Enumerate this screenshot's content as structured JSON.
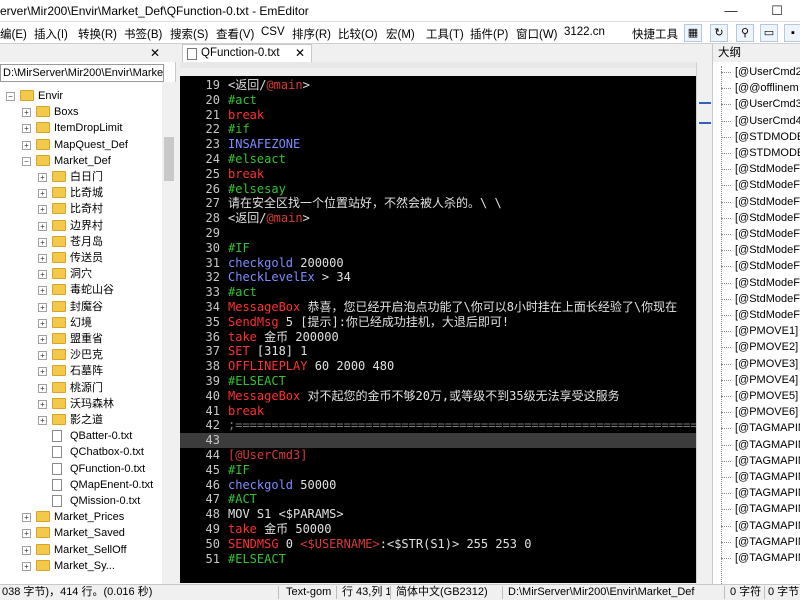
{
  "window": {
    "title": "erver\\Mir200\\Envir\\Market_Def\\QFunction-0.txt - EmEditor",
    "minimize": "—",
    "maximize": "☐"
  },
  "menu": {
    "items": [
      "编(E)",
      "插入(I)",
      "转换(R)",
      "书签(B)",
      "搜索(S)",
      "查看(V)",
      "CSV",
      "排序(R)",
      "比较(O)",
      "宏(M)",
      "工具(T)",
      "插件(P)",
      "窗口(W)",
      "3122.cn",
      "快捷工具"
    ]
  },
  "left_panel": {
    "path": "D:\\MirServer\\Mir200\\Envir\\Market",
    "close": "✕",
    "tree": [
      {
        "label": "Envir",
        "type": "folder",
        "level": 0,
        "expand": "−"
      },
      {
        "label": "Boxs",
        "type": "folder",
        "level": 1,
        "expand": "+"
      },
      {
        "label": "ItemDropLimit",
        "type": "folder",
        "level": 1,
        "expand": "+"
      },
      {
        "label": "MapQuest_Def",
        "type": "folder",
        "level": 1,
        "expand": "+"
      },
      {
        "label": "Market_Def",
        "type": "folder",
        "level": 1,
        "expand": "−"
      },
      {
        "label": "白日门",
        "type": "folder",
        "level": 2,
        "expand": "+"
      },
      {
        "label": "比奇城",
        "type": "folder",
        "level": 2,
        "expand": "+"
      },
      {
        "label": "比奇村",
        "type": "folder",
        "level": 2,
        "expand": "+"
      },
      {
        "label": "边界村",
        "type": "folder",
        "level": 2,
        "expand": "+"
      },
      {
        "label": "苍月岛",
        "type": "folder",
        "level": 2,
        "expand": "+"
      },
      {
        "label": "传送员",
        "type": "folder",
        "level": 2,
        "expand": "+"
      },
      {
        "label": "洞穴",
        "type": "folder",
        "level": 2,
        "expand": "+"
      },
      {
        "label": "毒蛇山谷",
        "type": "folder",
        "level": 2,
        "expand": "+"
      },
      {
        "label": "封魔谷",
        "type": "folder",
        "level": 2,
        "expand": "+"
      },
      {
        "label": "幻境",
        "type": "folder",
        "level": 2,
        "expand": "+"
      },
      {
        "label": "盟重省",
        "type": "folder",
        "level": 2,
        "expand": "+"
      },
      {
        "label": "沙巴克",
        "type": "folder",
        "level": 2,
        "expand": "+"
      },
      {
        "label": "石墓阵",
        "type": "folder",
        "level": 2,
        "expand": "+"
      },
      {
        "label": "桃源门",
        "type": "folder",
        "level": 2,
        "expand": "+"
      },
      {
        "label": "沃玛森林",
        "type": "folder",
        "level": 2,
        "expand": "+"
      },
      {
        "label": "影之道",
        "type": "folder",
        "level": 2,
        "expand": "+"
      },
      {
        "label": "QBatter-0.txt",
        "type": "file",
        "level": 2,
        "expand": ""
      },
      {
        "label": "QChatbox-0.txt",
        "type": "file",
        "level": 2,
        "expand": ""
      },
      {
        "label": "QFunction-0.txt",
        "type": "file",
        "level": 2,
        "expand": ""
      },
      {
        "label": "QMapEnent-0.txt",
        "type": "file",
        "level": 2,
        "expand": ""
      },
      {
        "label": "QMission-0.txt",
        "type": "file",
        "level": 2,
        "expand": ""
      },
      {
        "label": "Market_Prices",
        "type": "folder",
        "level": 1,
        "expand": "+"
      },
      {
        "label": "Market_Saved",
        "type": "folder",
        "level": 1,
        "expand": "+"
      },
      {
        "label": "Market_SellOff",
        "type": "folder",
        "level": 1,
        "expand": "+"
      },
      {
        "label": "Market_Sy...",
        "type": "folder",
        "level": 1,
        "expand": "+"
      }
    ]
  },
  "editor": {
    "tab_name": "QFunction-0.txt",
    "tab_close": "✕",
    "lines": [
      {
        "n": "19",
        "segs": [
          {
            "t": "<返回/",
            "c": "c-white"
          },
          {
            "t": "@main",
            "c": "c-label"
          },
          {
            "t": ">",
            "c": "c-white"
          }
        ]
      },
      {
        "n": "20",
        "segs": [
          {
            "t": "#act",
            "c": "c-green"
          }
        ]
      },
      {
        "n": "21",
        "segs": [
          {
            "t": "break",
            "c": "c-red"
          }
        ]
      },
      {
        "n": "22",
        "segs": [
          {
            "t": "#if",
            "c": "c-green"
          }
        ]
      },
      {
        "n": "23",
        "segs": [
          {
            "t": "INSAFEZONE",
            "c": "c-blue"
          }
        ]
      },
      {
        "n": "24",
        "segs": [
          {
            "t": "#elseact",
            "c": "c-green"
          }
        ]
      },
      {
        "n": "25",
        "segs": [
          {
            "t": "break",
            "c": "c-red"
          }
        ]
      },
      {
        "n": "26",
        "segs": [
          {
            "t": "#elsesay",
            "c": "c-green"
          }
        ]
      },
      {
        "n": "27",
        "segs": [
          {
            "t": "请在安全区找一个位置站好，不然会被人杀的。\\ \\",
            "c": "c-white"
          }
        ]
      },
      {
        "n": "28",
        "segs": [
          {
            "t": "<返回/",
            "c": "c-white"
          },
          {
            "t": "@main",
            "c": "c-label"
          },
          {
            "t": ">",
            "c": "c-white"
          }
        ]
      },
      {
        "n": "29",
        "segs": []
      },
      {
        "n": "30",
        "segs": [
          {
            "t": "#IF",
            "c": "c-green"
          }
        ]
      },
      {
        "n": "31",
        "segs": [
          {
            "t": "checkgold",
            "c": "c-blue"
          },
          {
            "t": " 200000",
            "c": "c-white"
          }
        ]
      },
      {
        "n": "32",
        "segs": [
          {
            "t": "CheckLevelEx",
            "c": "c-blue"
          },
          {
            "t": " > 34",
            "c": "c-white"
          }
        ]
      },
      {
        "n": "33",
        "segs": [
          {
            "t": "#act",
            "c": "c-green"
          }
        ]
      },
      {
        "n": "34",
        "segs": [
          {
            "t": "MessageBox",
            "c": "c-red"
          },
          {
            "t": " 恭喜，您已经开启泡点功能了\\你可以8小时挂在上面长经验了\\你现在",
            "c": "c-white"
          }
        ]
      },
      {
        "n": "35",
        "segs": [
          {
            "t": "SendMsg",
            "c": "c-red"
          },
          {
            "t": " 5 [提示]:你已经成功挂机，大退后即可!",
            "c": "c-white"
          }
        ]
      },
      {
        "n": "36",
        "segs": [
          {
            "t": "take",
            "c": "c-red"
          },
          {
            "t": " 金币 200000",
            "c": "c-white"
          }
        ]
      },
      {
        "n": "37",
        "segs": [
          {
            "t": "SET",
            "c": "c-red"
          },
          {
            "t": " [318] 1",
            "c": "c-white"
          }
        ]
      },
      {
        "n": "38",
        "segs": [
          {
            "t": "OFFLINEPLAY",
            "c": "c-red"
          },
          {
            "t": " 60 2000 480",
            "c": "c-white"
          }
        ]
      },
      {
        "n": "39",
        "segs": [
          {
            "t": "#ELSEACT",
            "c": "c-green"
          }
        ]
      },
      {
        "n": "40",
        "segs": [
          {
            "t": "MessageBox",
            "c": "c-red"
          },
          {
            "t": " 对不起您的金币不够20万,或等级不到35级无法享受这服务",
            "c": "c-white"
          }
        ]
      },
      {
        "n": "41",
        "segs": [
          {
            "t": "break",
            "c": "c-red"
          }
        ]
      },
      {
        "n": "42",
        "segs": [
          {
            "t": ";====================================================================",
            "c": "c-dim"
          }
        ]
      },
      {
        "n": "43",
        "segs": [],
        "current": true
      },
      {
        "n": "44",
        "segs": [
          {
            "t": "[@UserCmd3]",
            "c": "c-label"
          }
        ]
      },
      {
        "n": "45",
        "segs": [
          {
            "t": "#IF",
            "c": "c-green"
          }
        ]
      },
      {
        "n": "46",
        "segs": [
          {
            "t": "checkgold",
            "c": "c-blue"
          },
          {
            "t": " 50000",
            "c": "c-white"
          }
        ]
      },
      {
        "n": "47",
        "segs": [
          {
            "t": "#ACT",
            "c": "c-green"
          }
        ]
      },
      {
        "n": "48",
        "segs": [
          {
            "t": "MOV S1 <$PARAMS>",
            "c": "c-white"
          }
        ]
      },
      {
        "n": "49",
        "segs": [
          {
            "t": "take",
            "c": "c-red"
          },
          {
            "t": " 金币 50000",
            "c": "c-white"
          }
        ]
      },
      {
        "n": "50",
        "segs": [
          {
            "t": "SENDMSG",
            "c": "c-red"
          },
          {
            "t": " 0 ",
            "c": "c-white"
          },
          {
            "t": "<$USERNAME>",
            "c": "c-label"
          },
          {
            "t": ":<$STR(S1)> 255 253 0",
            "c": "c-white"
          }
        ]
      },
      {
        "n": "51",
        "segs": [
          {
            "t": "#ELSEACT",
            "c": "c-green"
          }
        ]
      }
    ]
  },
  "outline": {
    "title": "大纲",
    "items": [
      "[@UserCmd2",
      "[@@offlinem",
      "[@UserCmd3",
      "[@UserCmd4",
      "[@STDMODE",
      "[@STDMODE",
      "[@StdModeF",
      "[@StdModeF",
      "[@StdModeF",
      "[@StdModeF",
      "[@StdModeF",
      "[@StdModeF",
      "[@StdModeF",
      "[@StdModeF",
      "[@StdModeF",
      "[@StdModeF",
      "[@PMOVE1]",
      "[@PMOVE2]",
      "[@PMOVE3]",
      "[@PMOVE4]",
      "[@PMOVE5]",
      "[@PMOVE6]",
      "[@TAGMAPIN",
      "[@TAGMAPIN",
      "[@TAGMAPIN",
      "[@TAGMAPIN",
      "[@TAGMAPIN",
      "[@TAGMAPIN",
      "[@TAGMAPIN",
      "[@TAGMAPIN",
      "[@TAGMAPIN"
    ]
  },
  "status": {
    "left": "038 字节)，414 行。(0.016 秒)",
    "syntax": "Text-gom",
    "position": "行 43,列 1",
    "encoding": "简体中文(GB2312)",
    "path": "D:\\MirServer\\Mir200\\Envir\\Market_Def",
    "chars": "0 字符",
    "selection": "0 字节"
  }
}
